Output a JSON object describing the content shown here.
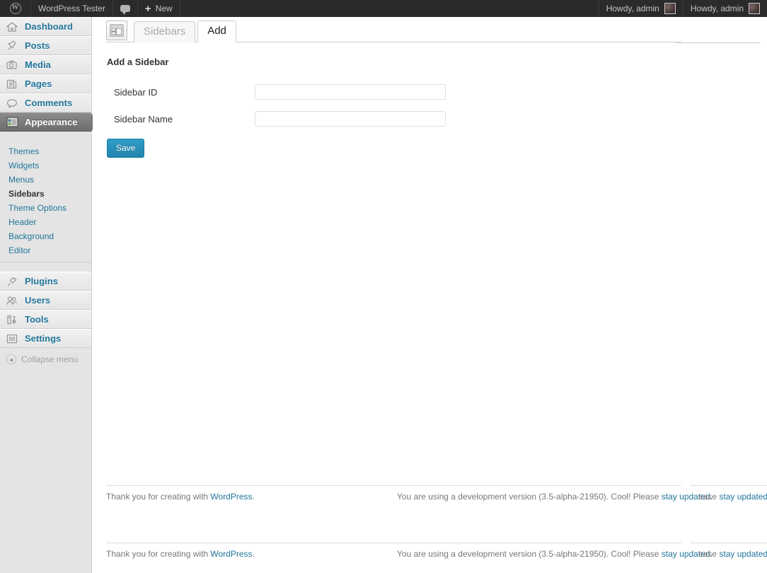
{
  "adminbar": {
    "logo_icon": "wordpress-logo-icon",
    "site_title": "WordPress Tester",
    "comments_icon": "comment-bubble-icon",
    "new_plus": "+",
    "new_label": "New",
    "account": [
      {
        "label": "Howdy, admin",
        "avatar_icon": "avatar-icon"
      },
      {
        "label": "Howdy, admin",
        "avatar_icon": "avatar-icon"
      }
    ]
  },
  "sidebar": {
    "items": [
      {
        "label": "Dashboard",
        "icon": "dashboard-home-icon",
        "current": false
      },
      {
        "label": "Posts",
        "icon": "pin-icon",
        "current": false
      },
      {
        "label": "Media",
        "icon": "camera-icon",
        "current": false
      },
      {
        "label": "Pages",
        "icon": "page-icon",
        "current": false
      },
      {
        "label": "Comments",
        "icon": "comment-icon",
        "current": false
      },
      {
        "label": "Appearance",
        "icon": "appearance-icon",
        "current": true
      },
      {
        "label": "Plugins",
        "icon": "plug-icon",
        "current": false
      },
      {
        "label": "Users",
        "icon": "users-icon",
        "current": false
      },
      {
        "label": "Tools",
        "icon": "tools-icon",
        "current": false
      },
      {
        "label": "Settings",
        "icon": "settings-icon",
        "current": false
      }
    ],
    "submenu": [
      {
        "label": "Themes",
        "current": false
      },
      {
        "label": "Widgets",
        "current": false
      },
      {
        "label": "Menus",
        "current": false
      },
      {
        "label": "Sidebars",
        "current": true
      },
      {
        "label": "Theme Options",
        "current": false
      },
      {
        "label": "Header",
        "current": false
      },
      {
        "label": "Background",
        "current": false
      },
      {
        "label": "Editor",
        "current": false
      }
    ],
    "collapse_label": "Collapse menu",
    "collapse_icon": "collapse-arrow-icon"
  },
  "page": {
    "screen_icon": "sidebar-layout-icon",
    "tabs": [
      {
        "label": "Sidebars",
        "active": false
      },
      {
        "label": "Add",
        "active": true
      }
    ],
    "heading": "Add a Sidebar",
    "fields": [
      {
        "label": "Sidebar ID",
        "value": "",
        "placeholder": ""
      },
      {
        "label": "Sidebar Name",
        "value": "",
        "placeholder": ""
      }
    ],
    "save_label": "Save"
  },
  "footer": {
    "thanks_prefix": "Thank you for creating with ",
    "wordpress_link": "WordPress",
    "thanks_suffix": ".",
    "version_text": "You are using a development version (3.5-alpha-21950). Cool! Please ",
    "stay_updated_link": "stay updated",
    "version_suffix": ".",
    "ghost_prefix": "ease ",
    "ghost_link": "stay updated",
    "ghost_suffix": "."
  },
  "colors": {
    "admin_bar": "#2b2b2b",
    "menu_bg": "#e4e4e4",
    "link": "#21759b",
    "primary_button": "#2383ab",
    "current_menu": "#6d6d6d"
  }
}
